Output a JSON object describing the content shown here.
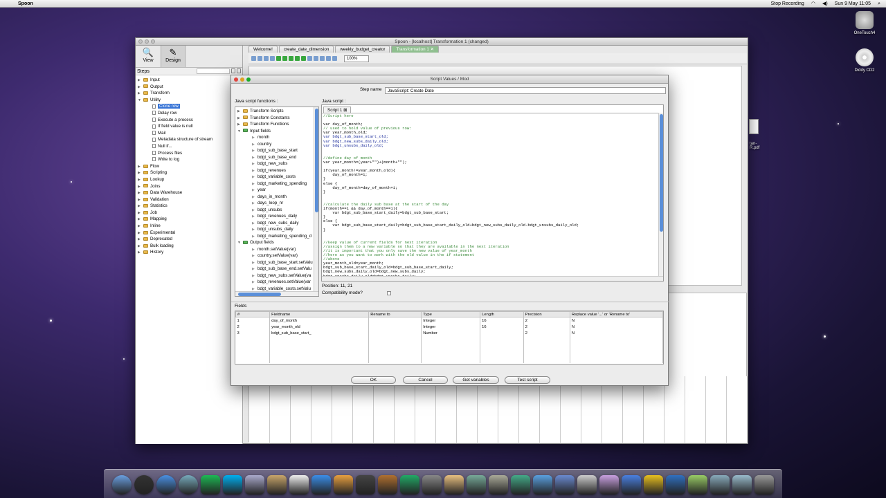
{
  "menubar": {
    "app": "Spoon",
    "status": "Stop Recording",
    "clock": "Sun 9 May  11:05"
  },
  "desktop": {
    "icons": [
      {
        "label": "OneTouch4"
      },
      {
        "label": "Diddy CD2"
      }
    ],
    "partial_file": "tan-\nR.pdf"
  },
  "spoon": {
    "title": "Spoon - [localhost] Transformation 1 (changed)",
    "perspectives": [
      {
        "label": "View"
      },
      {
        "label": "Design"
      }
    ],
    "steps_label": "Steps",
    "tree": [
      {
        "label": "Input",
        "type": "folder"
      },
      {
        "label": "Output",
        "type": "folder"
      },
      {
        "label": "Transform",
        "type": "folder"
      },
      {
        "label": "Utility",
        "type": "folder-open"
      },
      {
        "label": "Clone row",
        "type": "item",
        "selected": true
      },
      {
        "label": "Delay row",
        "type": "item"
      },
      {
        "label": "Execute a process",
        "type": "item"
      },
      {
        "label": "If field value is null",
        "type": "item"
      },
      {
        "label": "Mail",
        "type": "item"
      },
      {
        "label": "Metadata structure of stream",
        "type": "item"
      },
      {
        "label": "Null if...",
        "type": "item"
      },
      {
        "label": "Process files",
        "type": "item"
      },
      {
        "label": "Write to log",
        "type": "item"
      },
      {
        "label": "Flow",
        "type": "folder"
      },
      {
        "label": "Scripting",
        "type": "folder"
      },
      {
        "label": "Lookup",
        "type": "folder"
      },
      {
        "label": "Joins",
        "type": "folder"
      },
      {
        "label": "Data Warehouse",
        "type": "folder"
      },
      {
        "label": "Validation",
        "type": "folder"
      },
      {
        "label": "Statistics",
        "type": "folder"
      },
      {
        "label": "Job",
        "type": "folder"
      },
      {
        "label": "Mapping",
        "type": "folder"
      },
      {
        "label": "Inline",
        "type": "folder"
      },
      {
        "label": "Experimental",
        "type": "folder"
      },
      {
        "label": "Deprecated",
        "type": "folder"
      },
      {
        "label": "Bulk loading",
        "type": "folder"
      },
      {
        "label": "History",
        "type": "folder"
      }
    ],
    "tabs": [
      {
        "label": "Welcome!"
      },
      {
        "label": "create_date_dimension"
      },
      {
        "label": "weekly_budget_creator"
      },
      {
        "label": "Transformation 1 ✕"
      }
    ],
    "zoom": "100%"
  },
  "dialog": {
    "title": "Script Values / Mod",
    "step_name_label": "Step name",
    "step_name_value": "JavaScript: Create Date",
    "functions_label": "Java script functions :",
    "script_label": "Java script :",
    "script_tab": "Script 1",
    "position": "Position: 11, 21",
    "compat_label": "Compatibility mode?",
    "fields_label": "Fields",
    "functions_tree": [
      {
        "label": "Transform Scripts",
        "level": 0,
        "icon": "folder"
      },
      {
        "label": "Transform Constants",
        "level": 0,
        "icon": "folder"
      },
      {
        "label": "Transform Functions",
        "level": 0,
        "icon": "folder"
      },
      {
        "label": "Input fields",
        "level": 0,
        "icon": "fields"
      },
      {
        "label": "month",
        "level": 1
      },
      {
        "label": "country",
        "level": 1
      },
      {
        "label": "bdgt_sub_base_start",
        "level": 1
      },
      {
        "label": "bdgt_sub_base_end",
        "level": 1
      },
      {
        "label": "bdgt_new_subs",
        "level": 1
      },
      {
        "label": "bdgt_revenues",
        "level": 1
      },
      {
        "label": "bdgt_variable_costs",
        "level": 1
      },
      {
        "label": "bdgt_marketing_spending",
        "level": 1
      },
      {
        "label": "year",
        "level": 1
      },
      {
        "label": "days_in_month",
        "level": 1
      },
      {
        "label": "days_loop_nr",
        "level": 1
      },
      {
        "label": "bdgt_unsubs",
        "level": 1
      },
      {
        "label": "bdgt_revenues_daily",
        "level": 1
      },
      {
        "label": "bdgt_new_subs_daily",
        "level": 1
      },
      {
        "label": "bdgt_unsubs_daily",
        "level": 1
      },
      {
        "label": "bdgt_marketing_spending_d",
        "level": 1
      },
      {
        "label": "Output fields",
        "level": 0,
        "icon": "fields"
      },
      {
        "label": "month.setValue(var)",
        "level": 1
      },
      {
        "label": "country.setValue(var)",
        "level": 1
      },
      {
        "label": "bdgt_sub_base_start.setValu",
        "level": 1
      },
      {
        "label": "bdgt_sub_base_end.setValu",
        "level": 1
      },
      {
        "label": "bdgt_new_subs.setValue(va",
        "level": 1
      },
      {
        "label": "bdgt_revenues.setValue(var",
        "level": 1
      },
      {
        "label": "bdgt_variable_costs.setValu",
        "level": 1
      }
    ],
    "code_lines": [
      {
        "t": "//Script here",
        "c": "cm"
      },
      {
        "t": "",
        "c": "kw"
      },
      {
        "t": "var day_of_month;",
        "c": "kw"
      },
      {
        "t": "// used to hold value of previous row:",
        "c": "cm"
      },
      {
        "t": "var year_month_old;",
        "c": "kw"
      },
      {
        "t": "var bdgt_sub_base_start_old;",
        "c": "vr"
      },
      {
        "t": "var bdgt_new_subs_daily_old;",
        "c": "vr"
      },
      {
        "t": "var bdgt_unsubs_daily_old;",
        "c": "vr"
      },
      {
        "t": "",
        "c": "kw"
      },
      {
        "t": "",
        "c": "kw"
      },
      {
        "t": "//define day of month",
        "c": "cm"
      },
      {
        "t": "var year_month=(year+\"\")+(month+\"\");",
        "c": "kw"
      },
      {
        "t": "",
        "c": "kw"
      },
      {
        "t": "if(year_month!=year_month_old){",
        "c": "kw"
      },
      {
        "t": "    day_of_month=1;",
        "c": "kw"
      },
      {
        "t": "}",
        "c": "kw"
      },
      {
        "t": "else {",
        "c": "kw"
      },
      {
        "t": "    day_of_month=day_of_month+1;",
        "c": "kw"
      },
      {
        "t": "}",
        "c": "kw"
      },
      {
        "t": "",
        "c": "kw"
      },
      {
        "t": "",
        "c": "kw"
      },
      {
        "t": "//calculate the daily sub base at the start of the day",
        "c": "cm"
      },
      {
        "t": "if(month==1 && day_of_month==1){",
        "c": "kw"
      },
      {
        "t": "    var bdgt_sub_base_start_daily=bdgt_sub_base_start;",
        "c": "kw"
      },
      {
        "t": "}",
        "c": "kw"
      },
      {
        "t": "else {",
        "c": "kw"
      },
      {
        "t": "    var bdgt_sub_base_start_daily=bdgt_sub_base_start_daily_old+bdgt_new_subs_daily_old-bdgt_unsubs_daily_old;",
        "c": "kw"
      },
      {
        "t": "}",
        "c": "kw"
      },
      {
        "t": "",
        "c": "kw"
      },
      {
        "t": "",
        "c": "kw"
      },
      {
        "t": "//keep value of current fields for next iteration",
        "c": "cm"
      },
      {
        "t": "//assign them to a new variable so that they are available in the next iteration",
        "c": "cm"
      },
      {
        "t": "//it is important that you only save the new value of year_month",
        "c": "cm"
      },
      {
        "t": "//here as you want to work with the old value in the if statement",
        "c": "cm"
      },
      {
        "t": "//above",
        "c": "cm"
      },
      {
        "t": "year_month_old=year_month;",
        "c": "kw"
      },
      {
        "t": "bdgt_sub_base_start_daily_old=bdgt_sub_base_start_daily;",
        "c": "kw"
      },
      {
        "t": "bdgt_new_subs_daily_old=bdgt_new_subs_daily;",
        "c": "kw"
      },
      {
        "t": "bdgt_unsubs_daily_old=bdgt_unsubs_daily;",
        "c": "kw"
      }
    ],
    "fields_headers": [
      "#",
      "Fieldname",
      "Rename to",
      "Type",
      "Length",
      "Precision",
      "Replace value '...' or 'Rename to'"
    ],
    "fields_rows": [
      [
        "1",
        "day_of_month",
        "",
        "Integer",
        "16",
        "2",
        "N"
      ],
      [
        "2",
        "year_month_old",
        "",
        "Integer",
        "16",
        "2",
        "N"
      ],
      [
        "3",
        "bdgt_sub_base_start_",
        "",
        "Number",
        "",
        "2",
        "N"
      ]
    ],
    "buttons": {
      "ok": "OK",
      "cancel": "Cancel",
      "get_vars": "Get variables",
      "test": "Test script"
    }
  },
  "dock": {
    "icons": [
      "finder-icon",
      "dashboard-icon",
      "safari-icon",
      "facetime-icon",
      "spotify-icon",
      "skype-icon",
      "preview-icon",
      "contacts-icon",
      "ical-icon",
      "itunes-icon",
      "iphoto-icon",
      "imovie-icon",
      "garageband-icon",
      "time-machine-icon",
      "system-preferences-icon",
      "popcorn-icon",
      "keynote-icon",
      "utility-icon",
      "charts-icon",
      "people-icon",
      "chat-icon",
      "pref-icon",
      "textedit-icon",
      "google-icon",
      "folder-icon",
      "network-icon",
      "kettle-icon",
      "downloads-icon",
      "documents-icon",
      "trash-icon"
    ]
  }
}
